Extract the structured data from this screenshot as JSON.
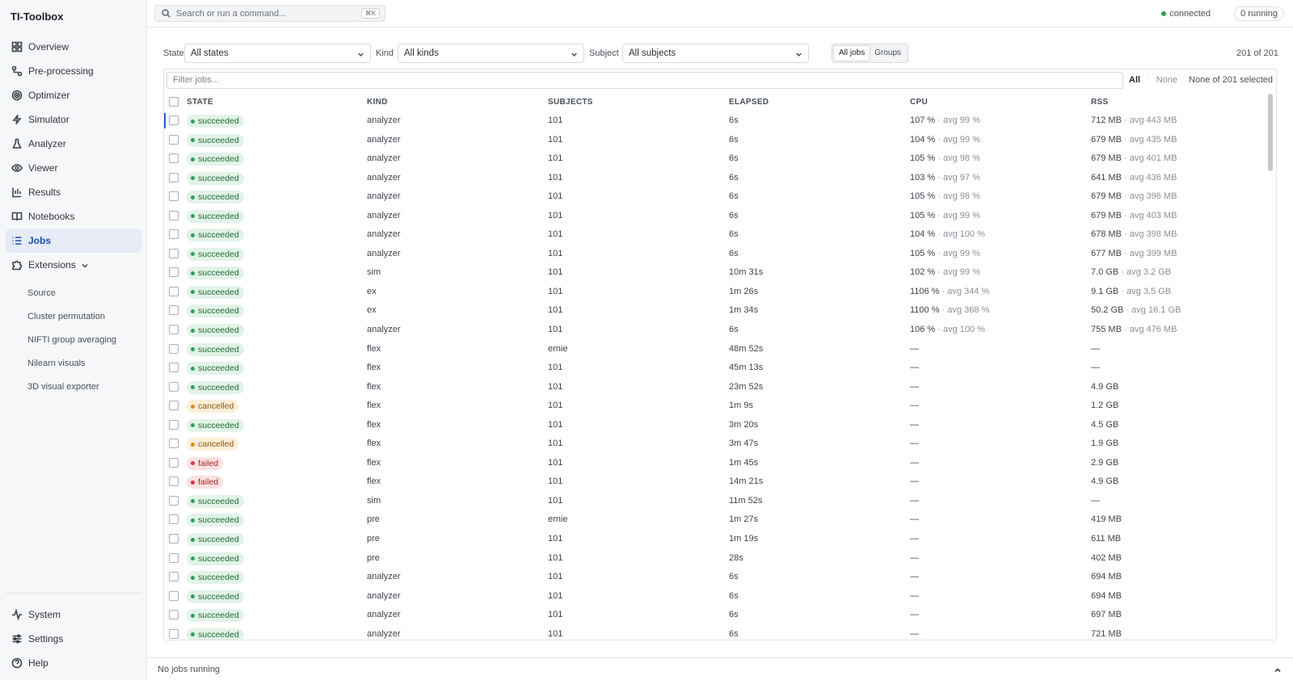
{
  "app": {
    "title": "TI-Toolbox"
  },
  "sidebar": {
    "items": [
      {
        "label": "Overview",
        "icon": "grid-icon"
      },
      {
        "label": "Pre-processing",
        "icon": "pipeline-icon"
      },
      {
        "label": "Optimizer",
        "icon": "target-icon"
      },
      {
        "label": "Simulator",
        "icon": "bolt-icon"
      },
      {
        "label": "Analyzer",
        "icon": "flask-icon"
      },
      {
        "label": "Viewer",
        "icon": "eye-icon"
      },
      {
        "label": "Results",
        "icon": "branch-icon"
      },
      {
        "label": "Notebooks",
        "icon": "book-icon"
      },
      {
        "label": "Jobs",
        "icon": "list-icon",
        "active": true
      },
      {
        "label": "Extensions",
        "icon": "puzzle-icon"
      }
    ],
    "extensions": [
      "Source",
      "Cluster permutation",
      "NIFTI group averaging",
      "Nilearn visuals",
      "3D visual exporter"
    ],
    "bottom": [
      {
        "label": "System",
        "icon": "activity-icon"
      },
      {
        "label": "Settings",
        "icon": "sliders-icon"
      },
      {
        "label": "Help",
        "icon": "help-icon"
      }
    ]
  },
  "topbar": {
    "search_placeholder": "Search or run a command...",
    "shortcut": "⌘K",
    "status": "connected",
    "running": "0 running",
    "status_color": "#2f9e57"
  },
  "filters": {
    "state_label": "State",
    "state_value": "All states",
    "kind_label": "Kind",
    "kind_value": "All kinds",
    "subject_label": "Subject",
    "subject_value": "All subjects",
    "toggle": [
      "All jobs",
      "Groups"
    ],
    "count": "201 of 201"
  },
  "table": {
    "filter_placeholder": "Filter jobs...",
    "select_all": "All",
    "select_sep": "·",
    "select_none": "None",
    "selection_info": "None of 201 selected",
    "columns": [
      "STATE",
      "KIND",
      "SUBJECTS",
      "ELAPSED",
      "CPU",
      "RSS"
    ],
    "rows": [
      {
        "state": "succeeded",
        "kind": "analyzer",
        "subjects": "101",
        "elapsed": "6s",
        "cpu": "107 %",
        "cpu_avg": "· avg 99 %",
        "rss": "712 MB",
        "rss_avg": "· avg 443 MB"
      },
      {
        "state": "succeeded",
        "kind": "analyzer",
        "subjects": "101",
        "elapsed": "6s",
        "cpu": "104 %",
        "cpu_avg": "· avg 99 %",
        "rss": "679 MB",
        "rss_avg": "· avg 435 MB"
      },
      {
        "state": "succeeded",
        "kind": "analyzer",
        "subjects": "101",
        "elapsed": "6s",
        "cpu": "105 %",
        "cpu_avg": "· avg 98 %",
        "rss": "679 MB",
        "rss_avg": "· avg 401 MB"
      },
      {
        "state": "succeeded",
        "kind": "analyzer",
        "subjects": "101",
        "elapsed": "6s",
        "cpu": "103 %",
        "cpu_avg": "· avg 97 %",
        "rss": "641 MB",
        "rss_avg": "· avg 436 MB"
      },
      {
        "state": "succeeded",
        "kind": "analyzer",
        "subjects": "101",
        "elapsed": "6s",
        "cpu": "105 %",
        "cpu_avg": "· avg 98 %",
        "rss": "679 MB",
        "rss_avg": "· avg 396 MB"
      },
      {
        "state": "succeeded",
        "kind": "analyzer",
        "subjects": "101",
        "elapsed": "6s",
        "cpu": "105 %",
        "cpu_avg": "· avg 99 %",
        "rss": "679 MB",
        "rss_avg": "· avg 403 MB"
      },
      {
        "state": "succeeded",
        "kind": "analyzer",
        "subjects": "101",
        "elapsed": "6s",
        "cpu": "104 %",
        "cpu_avg": "· avg 100 %",
        "rss": "678 MB",
        "rss_avg": "· avg 398 MB"
      },
      {
        "state": "succeeded",
        "kind": "analyzer",
        "subjects": "101",
        "elapsed": "6s",
        "cpu": "105 %",
        "cpu_avg": "· avg 99 %",
        "rss": "677 MB",
        "rss_avg": "· avg 399 MB"
      },
      {
        "state": "succeeded",
        "kind": "sim",
        "subjects": "101",
        "elapsed": "10m 31s",
        "cpu": "102 %",
        "cpu_avg": "· avg 99 %",
        "rss": "7.0 GB",
        "rss_avg": "· avg 3.2 GB"
      },
      {
        "state": "succeeded",
        "kind": "ex",
        "subjects": "101",
        "elapsed": "1m 26s",
        "cpu": "1106 %",
        "cpu_avg": "· avg 344 %",
        "rss": "9.1 GB",
        "rss_avg": "· avg 3.5 GB"
      },
      {
        "state": "succeeded",
        "kind": "ex",
        "subjects": "101",
        "elapsed": "1m 34s",
        "cpu": "1100 %",
        "cpu_avg": "· avg 368 %",
        "rss": "50.2 GB",
        "rss_avg": "· avg 16.1 GB"
      },
      {
        "state": "succeeded",
        "kind": "analyzer",
        "subjects": "101",
        "elapsed": "6s",
        "cpu": "106 %",
        "cpu_avg": "· avg 100 %",
        "rss": "755 MB",
        "rss_avg": "· avg 476 MB"
      },
      {
        "state": "succeeded",
        "kind": "flex",
        "subjects": "ernie",
        "elapsed": "48m 52s",
        "cpu": "—",
        "cpu_avg": "",
        "rss": "—",
        "rss_avg": ""
      },
      {
        "state": "succeeded",
        "kind": "flex",
        "subjects": "101",
        "elapsed": "45m 13s",
        "cpu": "—",
        "cpu_avg": "",
        "rss": "—",
        "rss_avg": ""
      },
      {
        "state": "succeeded",
        "kind": "flex",
        "subjects": "101",
        "elapsed": "23m 52s",
        "cpu": "—",
        "cpu_avg": "",
        "rss": "4.9 GB",
        "rss_avg": ""
      },
      {
        "state": "cancelled",
        "kind": "flex",
        "subjects": "101",
        "elapsed": "1m 9s",
        "cpu": "—",
        "cpu_avg": "",
        "rss": "1.2 GB",
        "rss_avg": ""
      },
      {
        "state": "succeeded",
        "kind": "flex",
        "subjects": "101",
        "elapsed": "3m 20s",
        "cpu": "—",
        "cpu_avg": "",
        "rss": "4.5 GB",
        "rss_avg": ""
      },
      {
        "state": "cancelled",
        "kind": "flex",
        "subjects": "101",
        "elapsed": "3m 47s",
        "cpu": "—",
        "cpu_avg": "",
        "rss": "1.9 GB",
        "rss_avg": ""
      },
      {
        "state": "failed",
        "kind": "flex",
        "subjects": "101",
        "elapsed": "1m 45s",
        "cpu": "—",
        "cpu_avg": "",
        "rss": "2.9 GB",
        "rss_avg": ""
      },
      {
        "state": "failed",
        "kind": "flex",
        "subjects": "101",
        "elapsed": "14m 21s",
        "cpu": "—",
        "cpu_avg": "",
        "rss": "4.9 GB",
        "rss_avg": ""
      },
      {
        "state": "succeeded",
        "kind": "sim",
        "subjects": "101",
        "elapsed": "11m 52s",
        "cpu": "—",
        "cpu_avg": "",
        "rss": "—",
        "rss_avg": ""
      },
      {
        "state": "succeeded",
        "kind": "pre",
        "subjects": "ernie",
        "elapsed": "1m 27s",
        "cpu": "—",
        "cpu_avg": "",
        "rss": "419 MB",
        "rss_avg": ""
      },
      {
        "state": "succeeded",
        "kind": "pre",
        "subjects": "101",
        "elapsed": "1m 19s",
        "cpu": "—",
        "cpu_avg": "",
        "rss": "611 MB",
        "rss_avg": ""
      },
      {
        "state": "succeeded",
        "kind": "pre",
        "subjects": "101",
        "elapsed": "28s",
        "cpu": "—",
        "cpu_avg": "",
        "rss": "402 MB",
        "rss_avg": ""
      },
      {
        "state": "succeeded",
        "kind": "analyzer",
        "subjects": "101",
        "elapsed": "6s",
        "cpu": "—",
        "cpu_avg": "",
        "rss": "694 MB",
        "rss_avg": ""
      },
      {
        "state": "succeeded",
        "kind": "analyzer",
        "subjects": "101",
        "elapsed": "6s",
        "cpu": "—",
        "cpu_avg": "",
        "rss": "694 MB",
        "rss_avg": ""
      },
      {
        "state": "succeeded",
        "kind": "analyzer",
        "subjects": "101",
        "elapsed": "6s",
        "cpu": "—",
        "cpu_avg": "",
        "rss": "697 MB",
        "rss_avg": ""
      },
      {
        "state": "succeeded",
        "kind": "analyzer",
        "subjects": "101",
        "elapsed": "6s",
        "cpu": "—",
        "cpu_avg": "",
        "rss": "721 MB",
        "rss_avg": ""
      }
    ]
  },
  "footer": {
    "text": "No jobs running"
  },
  "colors": {
    "accent": "#1e4fae",
    "succeeded": "#2f9e57",
    "cancelled": "#d68b16",
    "failed": "#d23b3b"
  }
}
